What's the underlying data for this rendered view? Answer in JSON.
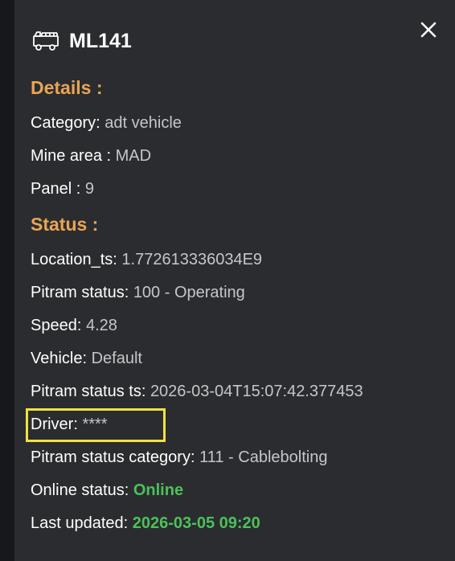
{
  "header": {
    "title": "ML141",
    "icon": "truck-icon",
    "close_icon": "close-icon"
  },
  "details": {
    "heading": "Details :",
    "rows": [
      {
        "label": "Category: ",
        "value": "adt vehicle"
      },
      {
        "label": "Mine area : ",
        "value": "MAD"
      },
      {
        "label": "Panel : ",
        "value": "9"
      }
    ]
  },
  "status": {
    "heading": "Status :",
    "rows": [
      {
        "label": "Location_ts: ",
        "value": "1.772613336034E9"
      },
      {
        "label": "Pitram status: ",
        "value": "100 - Operating"
      },
      {
        "label": "Speed: ",
        "value": "4.28"
      },
      {
        "label": "Vehicle: ",
        "value": "Default"
      },
      {
        "label": "Pitram status ts: ",
        "value": "2026-03-04T15:07:42.377453"
      },
      {
        "label": "Driver: ",
        "value": "****"
      },
      {
        "label": "Pitram status category: ",
        "value": "111 - Cablebolting"
      },
      {
        "label": "Online status: ",
        "value": "Online"
      },
      {
        "label": "Last updated: ",
        "value": "2026-03-05 09:20"
      }
    ]
  },
  "colors": {
    "accent": "#e8a555",
    "online": "#4cc15a",
    "highlight": "#f2e23c",
    "panel_bg": "#2b2c2f"
  }
}
